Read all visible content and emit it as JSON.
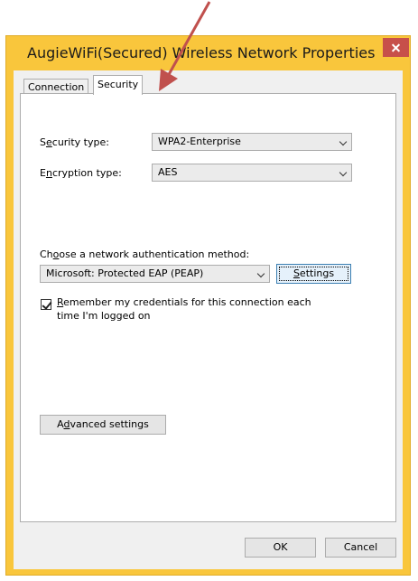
{
  "window": {
    "title": "AugieWiFi(Secured) Wireless Network Properties",
    "close_icon": "close-icon"
  },
  "tabs": [
    {
      "label": "Connection",
      "active": false
    },
    {
      "label": "Security",
      "active": true
    }
  ],
  "security": {
    "security_type_label": {
      "pre": "S",
      "ul": "e",
      "post": "curity type:"
    },
    "security_type_value": "WPA2-Enterprise",
    "encryption_type_label": {
      "pre": "E",
      "ul": "n",
      "post": "cryption type:"
    },
    "encryption_type_value": "AES",
    "auth_method_label": {
      "pre": "Ch",
      "ul": "o",
      "post": "ose a network authentication method:"
    },
    "auth_method_value": "Microsoft: Protected EAP (PEAP)",
    "settings_button": {
      "pre": "",
      "ul": "S",
      "post": "ettings"
    },
    "remember_checked": true,
    "remember_text": {
      "pre": "",
      "ul": "R",
      "post": "emember my credentials for this connection each",
      "line2": "time I'm logged on"
    },
    "advanced_button": {
      "pre": "A",
      "ul": "d",
      "post": "vanced settings"
    }
  },
  "footer": {
    "ok_label": "OK",
    "cancel_label": "Cancel"
  },
  "annotation": {
    "arrow_color": "#c0504d"
  }
}
